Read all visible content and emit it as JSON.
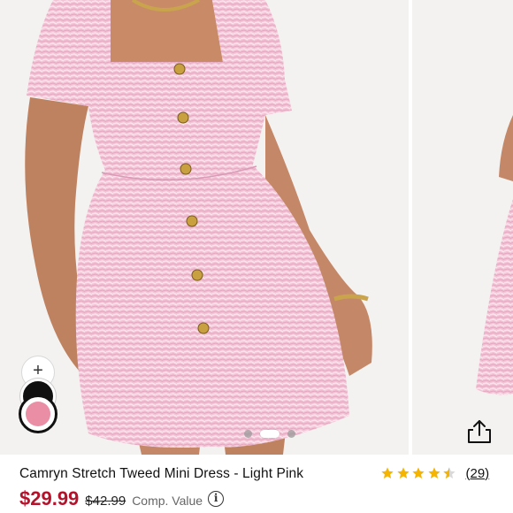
{
  "product": {
    "title": "Camryn Stretch Tweed Mini Dress - Light Pink",
    "price": "$29.99",
    "original_price": "$42.99",
    "comp_label": "Comp. Value",
    "rating": 4.5,
    "review_count": "(29)"
  },
  "gallery": {
    "slide_count": 3,
    "active_slide": 2
  },
  "swatches": {
    "add_label": "+",
    "colors": [
      {
        "name": "black",
        "hex": "#111111"
      },
      {
        "name": "light-pink",
        "hex": "#e98ea5",
        "selected": true
      }
    ]
  },
  "colors": {
    "price_red": "#b3132b",
    "star_gold": "#f5b400",
    "dress_pink": "#f0c2d4"
  },
  "icons": {
    "share": "share-icon",
    "info": "info-icon",
    "star": "star-icon"
  }
}
